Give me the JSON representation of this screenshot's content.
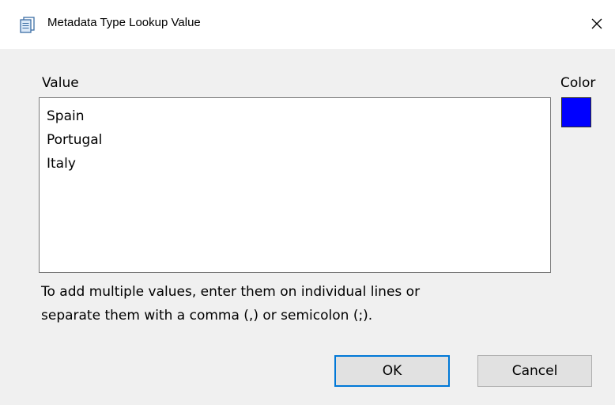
{
  "window": {
    "title": "Metadata Type Lookup Value"
  },
  "form": {
    "value_label": "Value",
    "color_label": "Color",
    "values": [
      "Spain",
      "Portugal",
      "Italy"
    ],
    "color": "#0000ff",
    "help_line1": "To add multiple values, enter them on individual lines or",
    "help_line2": "separate them with a comma (,) or semicolon (;)."
  },
  "buttons": {
    "ok": "OK",
    "cancel": "Cancel"
  },
  "icons": {
    "title": "document-icon",
    "close": "close-icon"
  }
}
